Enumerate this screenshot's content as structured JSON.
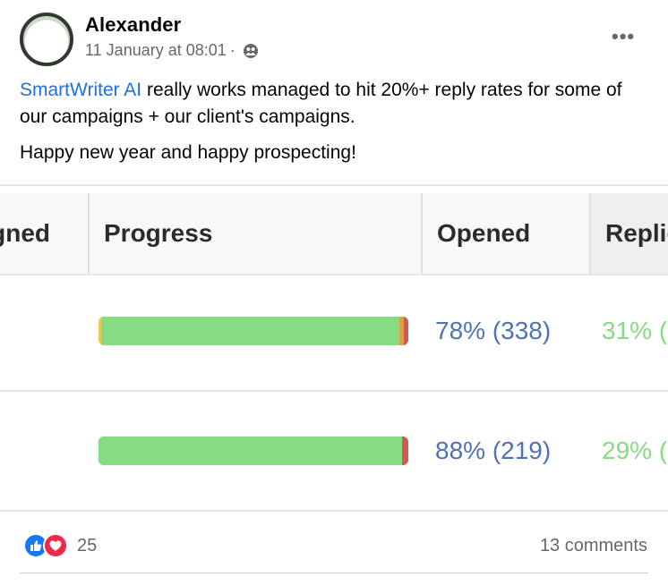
{
  "post": {
    "author": "Alexander",
    "timestamp": "11 January at 08:01",
    "separator": "·",
    "audience_icon": "friends-audience-icon",
    "more_label": "•••",
    "text_link": "SmartWriter AI",
    "text_line1_rest": " really works managed to hit 20%+ reply rates for some of our campaigns + our client's campaigns.",
    "text_line2": "Happy new year and happy prospecting!"
  },
  "table": {
    "headers": [
      "gned",
      "Progress",
      "Opened",
      "Replie"
    ],
    "rows": [
      {
        "opened": "78% (338)",
        "replied": "31% (",
        "progress_segments": [
          {
            "color": "#f2c94c",
            "fraction": 0.008
          },
          {
            "color": "#86db83",
            "fraction": 0.963
          },
          {
            "color": "#e09d49",
            "fraction": 0.015
          },
          {
            "color": "#d15b52",
            "fraction": 0.014
          }
        ]
      },
      {
        "opened": "88% (219)",
        "replied": "29% (",
        "progress_segments": [
          {
            "color": "#86db83",
            "fraction": 0.98
          },
          {
            "color": "#d15b52",
            "fraction": 0.02
          }
        ]
      }
    ]
  },
  "footer": {
    "reaction_icons": [
      "like-icon",
      "love-icon"
    ],
    "reaction_count": "25",
    "comments": "13 comments"
  },
  "colors": {
    "link": "#216fdb",
    "opened_text": "#4f72b0",
    "replied_text": "#86db83",
    "meta_text": "#65676b"
  }
}
